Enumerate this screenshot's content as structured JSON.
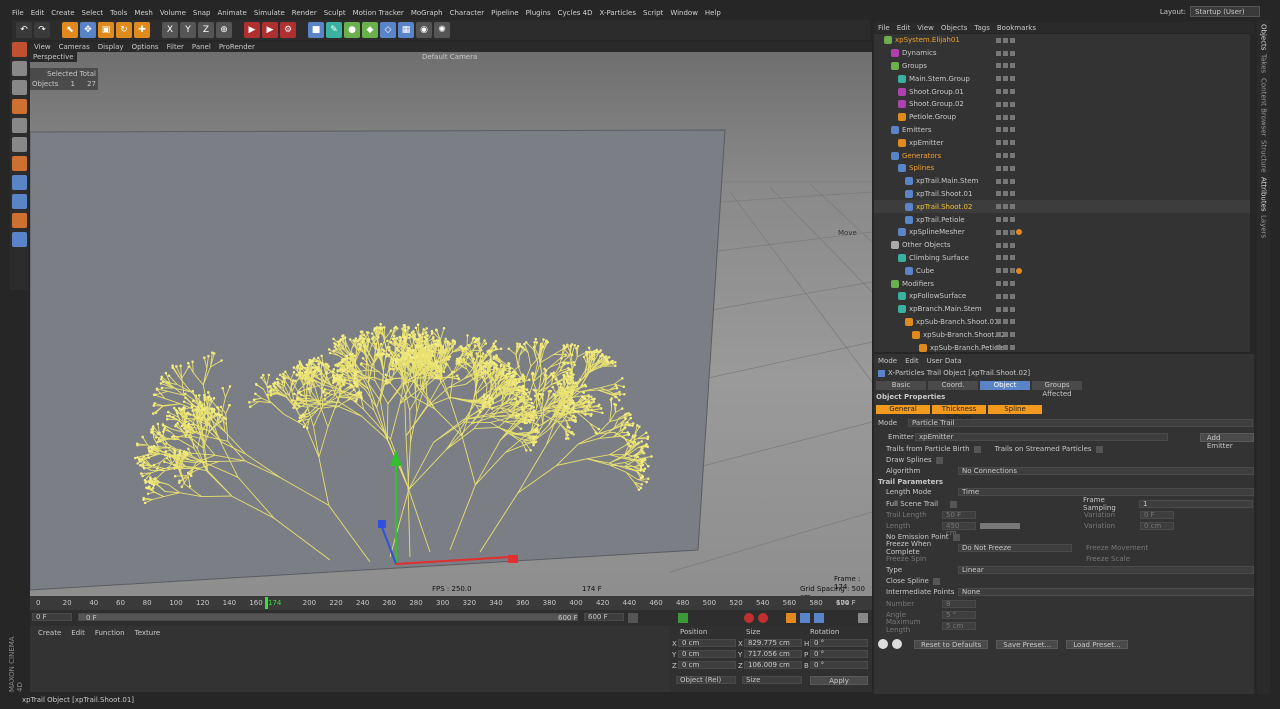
{
  "menu": [
    "File",
    "Edit",
    "Create",
    "Select",
    "Tools",
    "Mesh",
    "Volume",
    "Snap",
    "Animate",
    "Simulate",
    "Render",
    "Sculpt",
    "Motion Tracker",
    "MoGraph",
    "Character",
    "Pipeline",
    "Plugins",
    "Cycles 4D",
    "X-Particles",
    "Script",
    "Window",
    "Help"
  ],
  "layout": {
    "label": "Layout:",
    "value": "Startup (User)"
  },
  "viewport_menu": [
    "View",
    "Cameras",
    "Display",
    "Options",
    "Filter",
    "Panel",
    "ProRender"
  ],
  "viewport": {
    "name": "Perspective",
    "camera": "Default Camera",
    "stats_header": "Selected Total",
    "stats_label": "Objects",
    "stats_selected": "1",
    "stats_total": "27",
    "move": "Move",
    "frame": "Frame : 174",
    "grid": "Grid Spacing : 500 cm",
    "fps": "FPS : 250.0",
    "frame_label": "174 F"
  },
  "timeline": {
    "ticks": [
      "0",
      "20",
      "40",
      "60",
      "80",
      "100",
      "120",
      "140",
      "160",
      "174",
      "200",
      "220",
      "240",
      "260",
      "280",
      "300",
      "320",
      "340",
      "360",
      "380",
      "400",
      "420",
      "440",
      "460",
      "480",
      "500",
      "520",
      "540",
      "560",
      "580",
      "600"
    ],
    "current": 174,
    "end_label": "174 F"
  },
  "transport": {
    "start": "0 F",
    "preview_start": "0 F",
    "preview_end": "600 F",
    "end": "600 F"
  },
  "material_menu": [
    "Create",
    "Edit",
    "Function",
    "Texture"
  ],
  "coords": {
    "headers": [
      "Position",
      "Size",
      "Rotation"
    ],
    "rows": [
      {
        "axis": "X",
        "pos": "0 cm",
        "size_axis": "X",
        "size": "829.775 cm",
        "rot_axis": "H",
        "rot": "0 °"
      },
      {
        "axis": "Y",
        "pos": "0 cm",
        "size_axis": "Y",
        "size": "717.056 cm",
        "rot_axis": "P",
        "rot": "0 °"
      },
      {
        "axis": "Z",
        "pos": "0 cm",
        "size_axis": "Z",
        "size": "106.009 cm",
        "rot_axis": "B",
        "rot": "0 °"
      }
    ],
    "mode": "Object (Rel)",
    "size_mode": "Size",
    "apply": "Apply"
  },
  "status": "xpTrail Object [xpTrail.Shoot.01]",
  "object_manager": {
    "menu": [
      "File",
      "Edit",
      "View",
      "Objects",
      "Tags",
      "Bookmarks"
    ],
    "items": [
      {
        "label": "xpSystem.Elijah01",
        "indent": 0,
        "color": "#f0a030",
        "icon": "#6ab04c",
        "selected_text": true
      },
      {
        "label": "Dynamics",
        "indent": 1,
        "color": "#c8c8c8",
        "icon": "#b040b0"
      },
      {
        "label": "Groups",
        "indent": 1,
        "color": "#c8c8c8",
        "icon": "#6ab04c"
      },
      {
        "label": "Main.Stem.Group",
        "indent": 2,
        "color": "#c8c8c8",
        "icon": "#3ab0a0"
      },
      {
        "label": "Shoot.Group.01",
        "indent": 2,
        "color": "#c8c8c8",
        "icon": "#b040b0"
      },
      {
        "label": "Shoot.Group.02",
        "indent": 2,
        "color": "#c8c8c8",
        "icon": "#b040b0"
      },
      {
        "label": "Petiole.Group",
        "indent": 2,
        "color": "#c8c8c8",
        "icon": "#e08a1e"
      },
      {
        "label": "Emitters",
        "indent": 1,
        "color": "#c8c8c8",
        "icon": "#5a84c8"
      },
      {
        "label": "xpEmitter",
        "indent": 2,
        "color": "#c8c8c8",
        "icon": "#e08a1e"
      },
      {
        "label": "Generators",
        "indent": 1,
        "color": "#f0a030",
        "icon": "#5a84c8"
      },
      {
        "label": "Splines",
        "indent": 2,
        "color": "#f0a030",
        "icon": "#5a84c8"
      },
      {
        "label": "xpTrail.Main.Stem",
        "indent": 3,
        "color": "#c8c8c8",
        "icon": "#5a84c8"
      },
      {
        "label": "xpTrail.Shoot.01",
        "indent": 3,
        "color": "#c8c8c8",
        "icon": "#5a84c8"
      },
      {
        "label": "xpTrail.Shoot.02",
        "indent": 3,
        "color": "#f0c030",
        "icon": "#5a84c8"
      },
      {
        "label": "xpTrail.Petiole",
        "indent": 3,
        "color": "#c8c8c8",
        "icon": "#5a84c8"
      },
      {
        "label": "xpSplineMesher",
        "indent": 2,
        "color": "#c8c8c8",
        "icon": "#5a84c8",
        "tag": true
      },
      {
        "label": "Other Objects",
        "indent": 1,
        "color": "#c8c8c8",
        "icon": "#aaaaaa"
      },
      {
        "label": "Climbing Surface",
        "indent": 2,
        "color": "#c8c8c8",
        "icon": "#3ab0a0"
      },
      {
        "label": "Cube",
        "indent": 3,
        "color": "#c8c8c8",
        "icon": "#5a84c8",
        "tag": true
      },
      {
        "label": "Modifiers",
        "indent": 1,
        "color": "#c8c8c8",
        "icon": "#6ab04c"
      },
      {
        "label": "xpFollowSurface",
        "indent": 2,
        "color": "#c8c8c8",
        "icon": "#3ab0a0"
      },
      {
        "label": "xpBranch.Main.Stem",
        "indent": 2,
        "color": "#c8c8c8",
        "icon": "#3ab0a0"
      },
      {
        "label": "xpSub-Branch.Shoot.01",
        "indent": 3,
        "color": "#c8c8c8",
        "icon": "#e08a1e"
      },
      {
        "label": "xpSub-Branch.Shoot.02",
        "indent": 4,
        "color": "#c8c8c8",
        "icon": "#e08a1e"
      },
      {
        "label": "xpSub-Branch.Petiole",
        "indent": 5,
        "color": "#c8c8c8",
        "icon": "#e08a1e"
      }
    ]
  },
  "attributes": {
    "menu": [
      "Mode",
      "Edit",
      "User Data"
    ],
    "title": "X-Particles Trail Object [xpTrail.Shoot.02]",
    "tabs": [
      "Basic",
      "Coord.",
      "Object",
      "Groups Affected"
    ],
    "active_tab": "Object",
    "section": "Object Properties",
    "subtabs": [
      "General",
      "Thickness & Color",
      "Spline"
    ],
    "mode_label": "Mode",
    "mode_value": "Particle Trail",
    "emitter_label": "Emitter",
    "emitter_value": "xpEmitter",
    "add_emitter": "Add Emitter",
    "trails_birth": "Trails from Particle Birth",
    "trails_streamed": "Trails on Streamed Particles",
    "draw_splines": "Draw Splines",
    "algorithm_label": "Algorithm",
    "algorithm_value": "No Connections",
    "trail_params": "Trail Parameters",
    "length_mode_label": "Length Mode",
    "length_mode_value": "Time",
    "full_scene": "Full Scene Trail",
    "frame_sampling_label": "Frame Sampling",
    "frame_sampling_value": "1",
    "trail_length_label": "Trail Length",
    "trail_length_value": "50 F",
    "variation_label": "Variation",
    "variation_value": "0 F",
    "length_label": "Length",
    "length_value": "450 cm",
    "variation2_value": "0 cm",
    "no_emission": "No Emission Point",
    "freeze_label": "Freeze When Complete",
    "freeze_value": "Do Not Freeze",
    "freeze_movement": "Freeze Movement",
    "freeze_spin": "Freeze Spin",
    "freeze_scale": "Freeze Scale",
    "type_label": "Type",
    "type_value": "Linear",
    "close_spline": "Close Spline",
    "intermediate_label": "Intermediate Points",
    "intermediate_value": "None",
    "number_label": "Number",
    "number_value": "8",
    "angle_label": "Angle",
    "angle_value": "5 °",
    "max_length_label": "Maximum Length",
    "max_length_value": "5 cm",
    "reset": "Reset to Defaults",
    "save": "Save Preset...",
    "load": "Load Preset..."
  },
  "right_tabs": [
    "Objects",
    "Takes",
    "Content Browser",
    "Structure",
    "Attributes",
    "Layers"
  ],
  "brand": "MAXON CINEMA 4D"
}
